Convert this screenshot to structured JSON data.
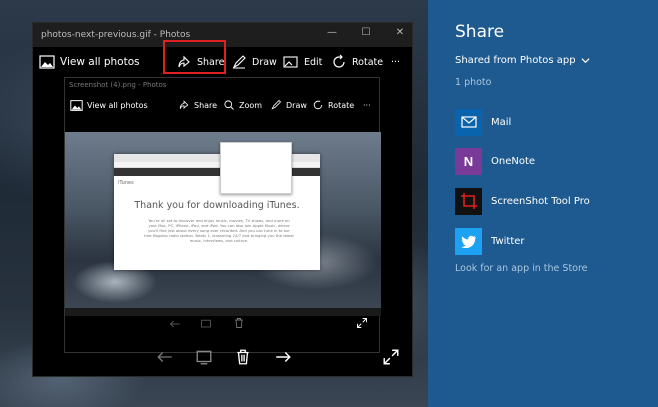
{
  "window": {
    "title": "photos-next-previous.gif - Photos"
  },
  "toolbar": {
    "view_all": "View all photos",
    "share": "Share",
    "draw": "Draw",
    "edit": "Edit",
    "rotate": "Rotate",
    "more": "···"
  },
  "inner": {
    "title": "Screenshot (4).png - Photos",
    "view_all": "View all photos",
    "share": "Share",
    "zoom": "Zoom",
    "draw": "Draw",
    "rotate": "Rotate",
    "more": "···",
    "itunes_label": "iTunes",
    "thank_you": "Thank you for downloading iTunes.",
    "body": "You're all set to discover and enjoy music, movies, TV shows, and more on your Mac, PC, iPhone, iPad, and iPod. You can also join Apple Music, where you'll find just about every song ever recorded. And you can tune in to our free flagship radio station, Beats 1, streaming 24/7 and bringing you the latest music, interviews, and culture."
  },
  "share_panel": {
    "title": "Share",
    "from": "Shared from Photos app",
    "count": "1 photo",
    "apps": [
      {
        "label": "Mail",
        "color": "#0a64ad"
      },
      {
        "label": "OneNote",
        "color": "#7a3a98"
      },
      {
        "label": "ScreenShot Tool Pro",
        "color": "#111111"
      },
      {
        "label": "Twitter",
        "color": "#1da1f2"
      }
    ],
    "store_link": "Look for an app in the Store"
  },
  "colors": {
    "panel_bg": "#1e5a8f",
    "highlight": "#e02020"
  }
}
